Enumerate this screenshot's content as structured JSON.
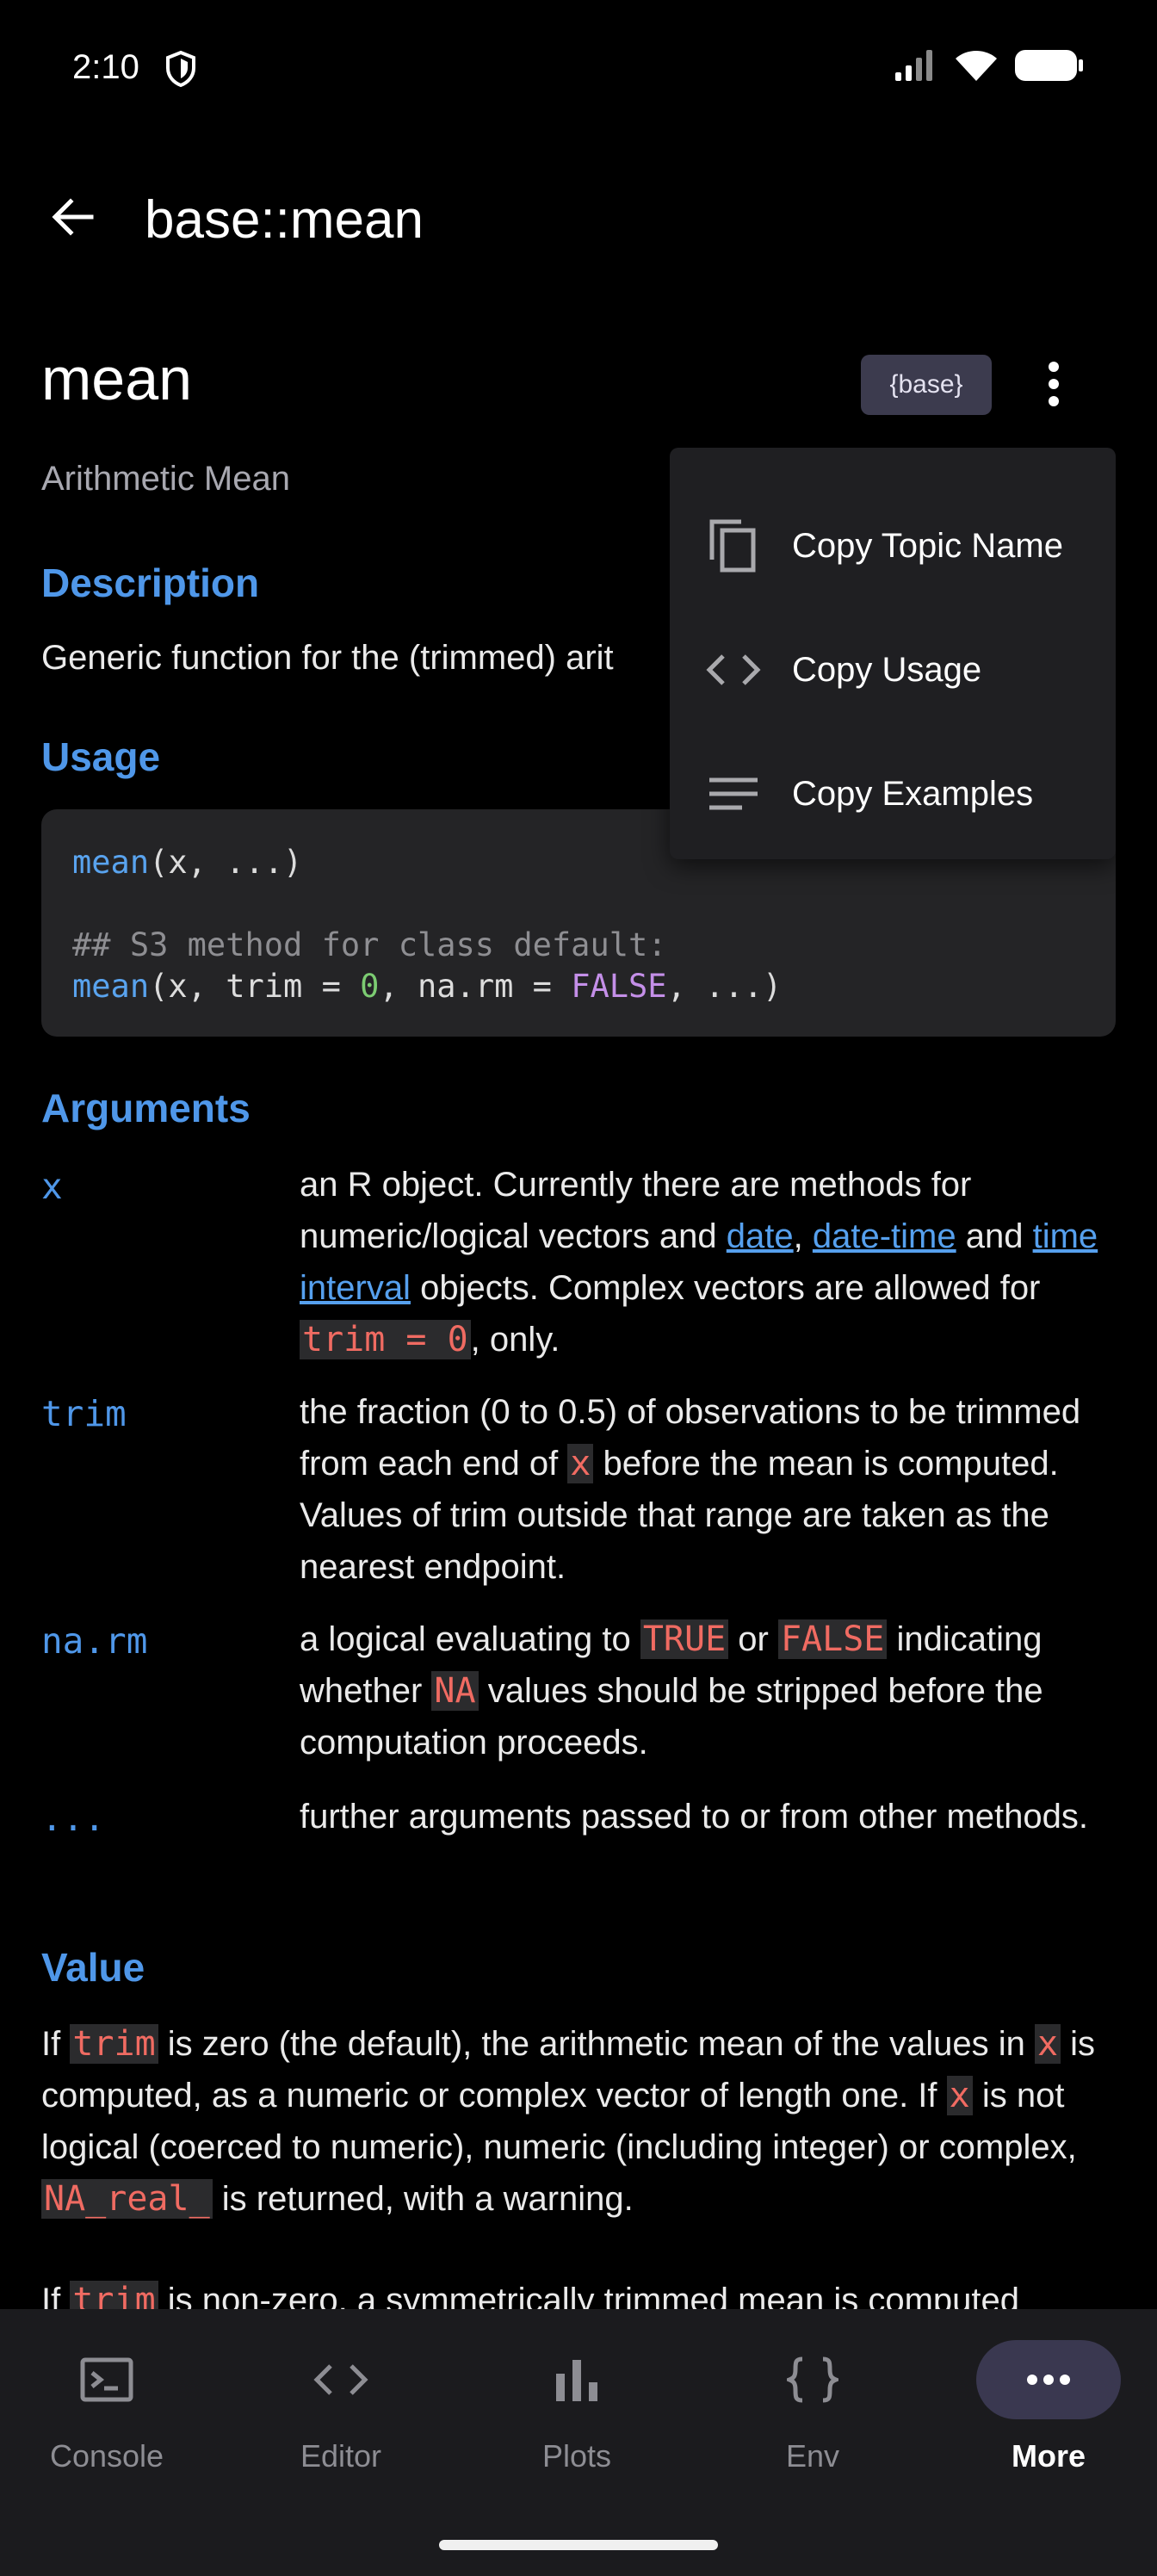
{
  "status_bar": {
    "time": "2:10"
  },
  "app_bar": {
    "title": "base::mean"
  },
  "topic": {
    "name": "mean",
    "package": "{base}",
    "subtitle": "Arithmetic Mean"
  },
  "menu": {
    "items": [
      {
        "label": "Copy Topic Name",
        "icon": "copy-icon"
      },
      {
        "label": "Copy Usage",
        "icon": "code-icon"
      },
      {
        "label": "Copy Examples",
        "icon": "lines-icon"
      }
    ]
  },
  "description": {
    "heading": "Description",
    "text": "Generic function for the (trimmed) arit"
  },
  "usage": {
    "heading": "Usage",
    "line1": {
      "fn": "mean",
      "rest": "(x, ...)"
    },
    "comment": "## S3 method for class default:",
    "line2": {
      "fn": "mean",
      "p1": "(x, trim = ",
      "num": "0",
      "p2": ", na.rm = ",
      "kw": "FALSE",
      "p3": ", ...)"
    }
  },
  "arguments": {
    "heading": "Arguments",
    "items": [
      {
        "name": "x",
        "t1": "an R object. Currently there are methods for numeric/logical vectors and ",
        "link1": "date",
        "t2": ", ",
        "link2": "date-time",
        "t3": " and ",
        "link3": "time interval",
        "t4": " objects. Complex vectors are allowed for ",
        "code1": "trim = 0",
        "t5": ", only."
      },
      {
        "name": "trim",
        "t1": "the fraction (0 to 0.5) of observations to be trimmed from each end of ",
        "code1": "x",
        "t2": " before the mean is computed. Values of trim outside that range are taken as the nearest endpoint."
      },
      {
        "name": "na.rm",
        "t1": "a logical evaluating to ",
        "code1": "TRUE",
        "t2": " or ",
        "code2": "FALSE",
        "t3": " indicating whether ",
        "code3": "NA",
        "t4": " values should be stripped before the computation proceeds."
      },
      {
        "name": "...",
        "t1": "further arguments passed to or from other methods."
      }
    ]
  },
  "value": {
    "heading": "Value",
    "p1": {
      "t1": "If ",
      "code1": "trim",
      "t2": " is zero (the default), the arithmetic mean of the values in ",
      "code2": "x",
      "t3": " is computed, as a numeric or complex vector of length one. If ",
      "code3": "x",
      "t4": " is not logical (coerced to numeric), numeric (including integer) or complex, ",
      "code4": "NA_real_",
      "t5": " is returned, with a warning."
    },
    "p2": {
      "t1": "If ",
      "code1": "trim",
      "t2": " is non-zero, a symmetrically trimmed mean is computed"
    }
  },
  "bottom_nav": {
    "items": [
      {
        "label": "Console",
        "icon": "console-icon",
        "active": false
      },
      {
        "label": "Editor",
        "icon": "code-icon",
        "active": false
      },
      {
        "label": "Plots",
        "icon": "bar-chart-icon",
        "active": false
      },
      {
        "label": "Env",
        "icon": "braces-icon",
        "active": false
      },
      {
        "label": "More",
        "icon": "more-horizontal-icon",
        "active": true
      }
    ]
  }
}
